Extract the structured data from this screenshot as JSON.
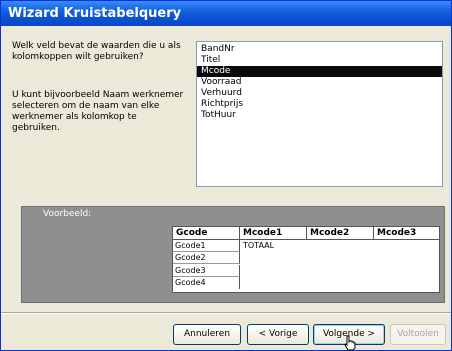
{
  "window": {
    "title": "Wizard Kruistabelquery"
  },
  "prompt": {
    "question": "Welk veld bevat de waarden die u als kolomkoppen wilt gebruiken?",
    "hint": "U kunt bijvoorbeeld Naam werknemer selecteren om de naam van elke werknemer als kolomkop te gebruiken."
  },
  "fields": [
    {
      "label": "BandNr",
      "selected": false
    },
    {
      "label": "Titel",
      "selected": false
    },
    {
      "label": "Mcode",
      "selected": true
    },
    {
      "label": "Voorraad",
      "selected": false
    },
    {
      "label": "Verhuurd",
      "selected": false
    },
    {
      "label": "Richtprijs",
      "selected": false
    },
    {
      "label": "TotHuur",
      "selected": false
    }
  ],
  "preview": {
    "label": "Voorbeeld:",
    "columns": [
      "Gcode",
      "Mcode1",
      "Mcode2",
      "Mcode3"
    ],
    "rows": [
      "Gcode1",
      "Gcode2",
      "Gcode3",
      "Gcode4"
    ],
    "total_label": "TOTAAL"
  },
  "buttons": {
    "cancel": "Annuleren",
    "back": "< Vorige",
    "next": "Volgende >",
    "finish": "Voltooien"
  },
  "colors": {
    "titlebar": "#0a4fd4",
    "selection": "#0a0a0a",
    "preview_bg": "#8f8f8f"
  }
}
